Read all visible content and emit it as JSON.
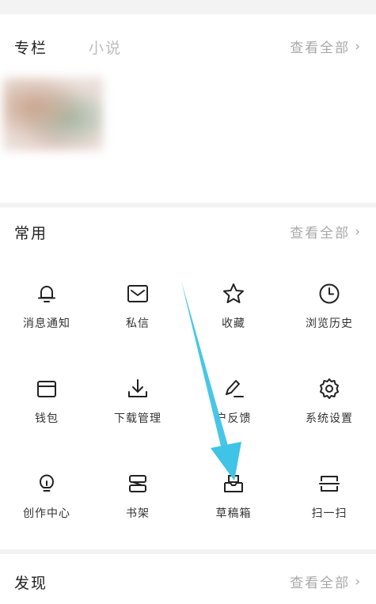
{
  "columns_section": {
    "title": "专栏",
    "tab": "小说",
    "see_all": "查看全部"
  },
  "common_section": {
    "title": "常用",
    "see_all": "查看全部",
    "items": [
      {
        "label": "消息通知",
        "icon": "bell-icon"
      },
      {
        "label": "私信",
        "icon": "mail-icon"
      },
      {
        "label": "收藏",
        "icon": "star-icon"
      },
      {
        "label": "浏览历史",
        "icon": "clock-icon"
      },
      {
        "label": "钱包",
        "icon": "wallet-icon"
      },
      {
        "label": "下载管理",
        "icon": "download-icon"
      },
      {
        "label": "户反馈",
        "icon": "pen-feedback-icon"
      },
      {
        "label": "系统设置",
        "icon": "gear-icon"
      },
      {
        "label": "创作中心",
        "icon": "bulb-icon"
      },
      {
        "label": "书架",
        "icon": "bookshelf-icon"
      },
      {
        "label": "草稿箱",
        "icon": "draft-box-icon"
      },
      {
        "label": "扫一扫",
        "icon": "scan-icon"
      }
    ]
  },
  "discover_section": {
    "title": "发现",
    "see_all": "查看全部"
  },
  "colors": {
    "annotation_arrow": "#3fc3e6",
    "icon_stroke": "#222222",
    "muted_text": "#a8a8a8"
  }
}
